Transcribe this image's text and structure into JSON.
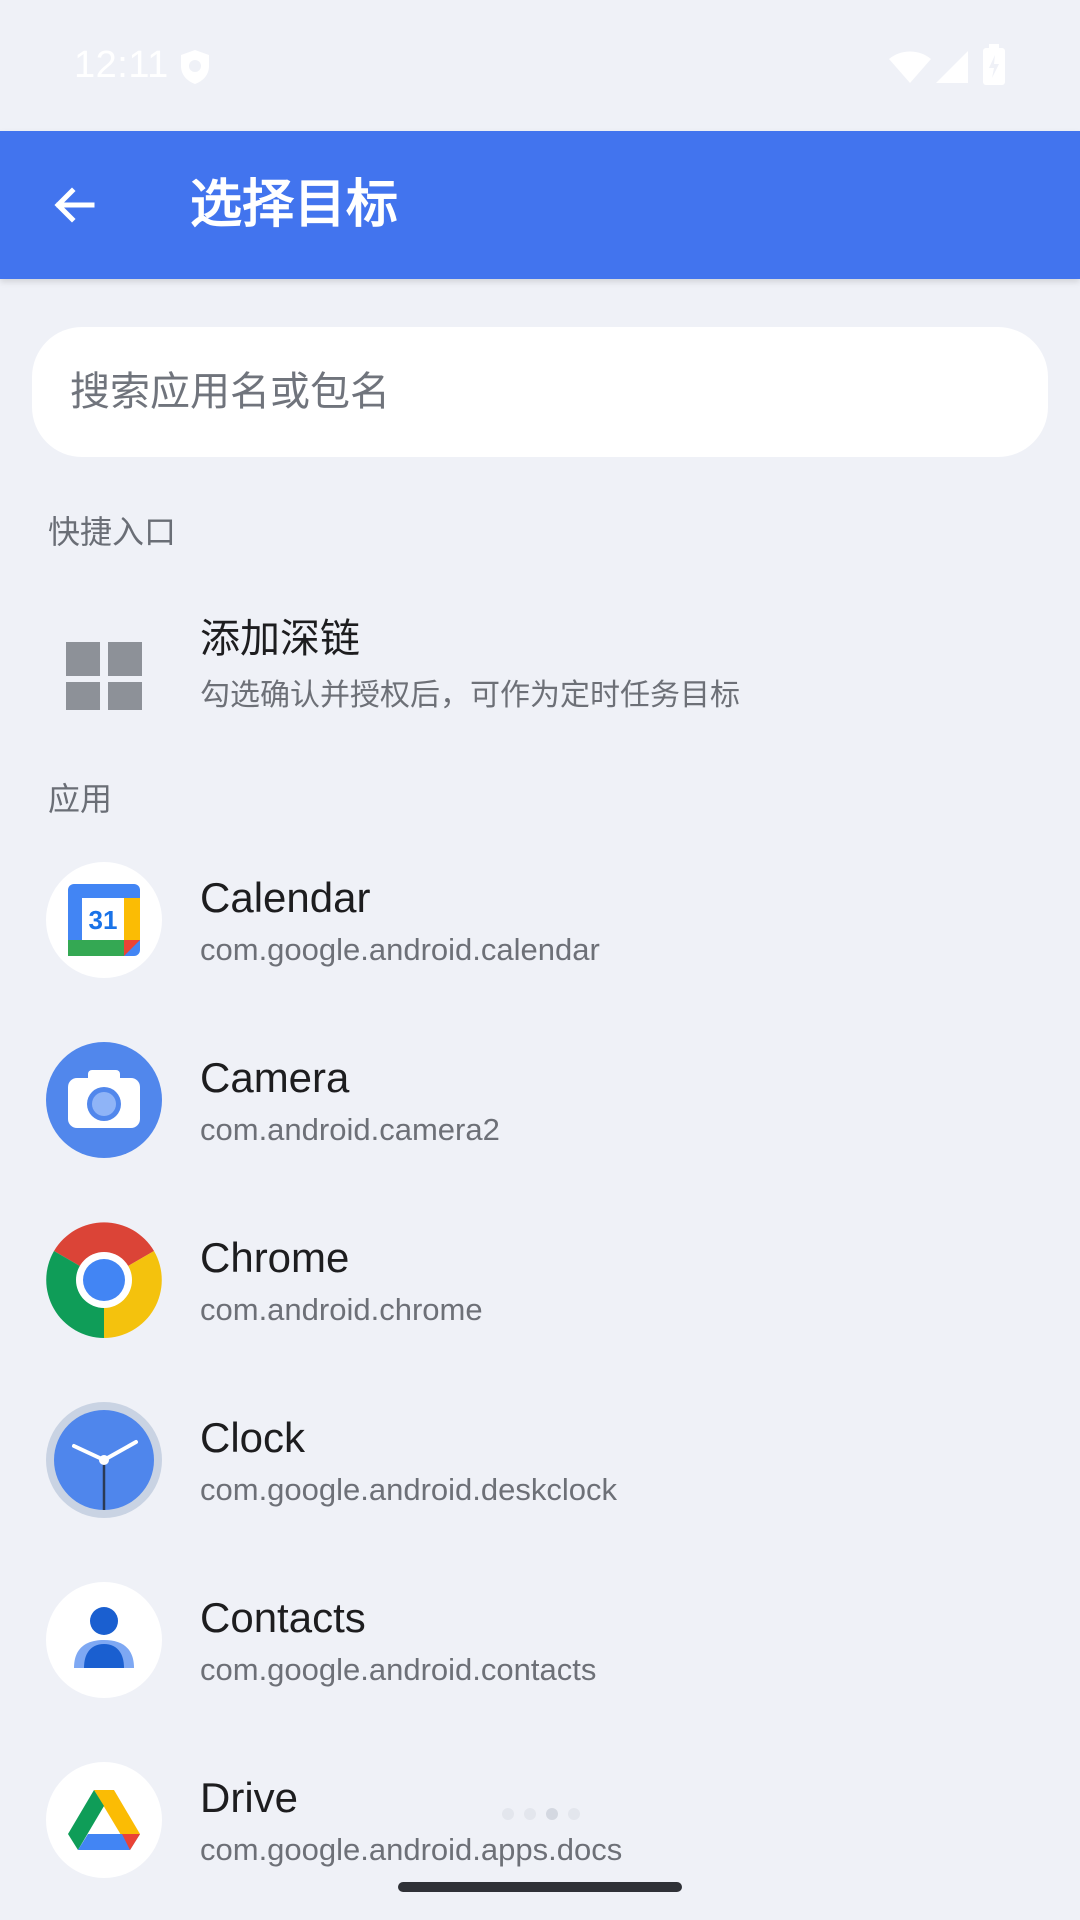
{
  "status_bar": {
    "time": "12:11",
    "icons": [
      "shield-icon",
      "wifi-icon",
      "signal-icon",
      "battery-icon"
    ]
  },
  "app_bar": {
    "title": "选择目标",
    "back_icon": "arrow-back-icon"
  },
  "search": {
    "placeholder": "搜索应用名或包名",
    "value": ""
  },
  "shortcuts": {
    "header": "快捷入口",
    "items": [
      {
        "title": "添加深链",
        "subtitle": "勾选确认并授权后，可作为定时任务目标",
        "icon": "grid-icon"
      }
    ]
  },
  "apps": {
    "header": "应用",
    "items": [
      {
        "name": "Calendar",
        "package": "com.google.android.calendar",
        "icon": "calendar-icon",
        "icon_text": "31"
      },
      {
        "name": "Camera",
        "package": "com.android.camera2",
        "icon": "camera-icon"
      },
      {
        "name": "Chrome",
        "package": "com.android.chrome",
        "icon": "chrome-icon"
      },
      {
        "name": "Clock",
        "package": "com.google.android.deskclock",
        "icon": "clock-icon"
      },
      {
        "name": "Contacts",
        "package": "com.google.android.contacts",
        "icon": "contacts-icon"
      },
      {
        "name": "Drive",
        "package": "com.google.android.apps.docs",
        "icon": "drive-icon"
      }
    ]
  },
  "colors": {
    "app_bar": "#4274ee",
    "background": "#eff1f7",
    "search_bg": "#ffffff",
    "secondary_text": "#6d7077"
  }
}
